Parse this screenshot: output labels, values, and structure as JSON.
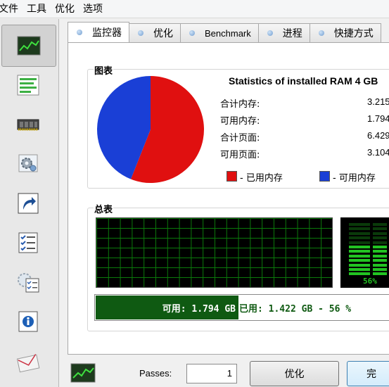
{
  "menu": [
    "文件",
    "工具",
    "优化",
    "选项"
  ],
  "sidebar": {
    "items": [
      {
        "icon": "monitor-chart-icon",
        "active": true
      },
      {
        "icon": "list-bars-icon"
      },
      {
        "icon": "ram-chip-icon"
      },
      {
        "icon": "gear-settings-icon"
      },
      {
        "icon": "shortcut-arrow-icon"
      },
      {
        "icon": "checklist-icon"
      },
      {
        "icon": "settings-checklist-icon"
      },
      {
        "icon": "info-icon"
      },
      {
        "icon": "mail-icon"
      }
    ]
  },
  "tabs": [
    {
      "label": "监控器",
      "active": true
    },
    {
      "label": "优化"
    },
    {
      "label": "Benchmark"
    },
    {
      "label": "进程"
    },
    {
      "label": "快捷方式"
    }
  ],
  "chart_group": {
    "title": "图表",
    "stats_title": "Statistics of installed RAM 4 GB",
    "rows": [
      {
        "label": "合计内存:",
        "value": "3.215"
      },
      {
        "label": "可用内存:",
        "value": "1.794"
      },
      {
        "label": "合计页面:",
        "value": "6.429"
      },
      {
        "label": "可用页面:",
        "value": "3.104"
      }
    ],
    "legend": [
      {
        "label": "- 已用内存",
        "color": "#e01010"
      },
      {
        "label": "- 可用内存",
        "color": "#1a3fd6"
      }
    ]
  },
  "chart_data": {
    "type": "pie",
    "labels": [
      "已用内存",
      "可用内存"
    ],
    "values": [
      56,
      44
    ],
    "colors": [
      "#e01010",
      "#1a3fd6"
    ]
  },
  "summary_group": {
    "title": "总表",
    "meter_label": "56%",
    "free_text": "可用: 1.794 GB",
    "used_text": "已用: 1.422 GB - 56 %",
    "usage_percent": 56,
    "colors": {
      "graph_line": "#0b7a0b",
      "meter": "#22c322",
      "bar": "#0f5a12"
    }
  },
  "footer": {
    "passes_label": "Passes:",
    "passes_value": "1",
    "optimize_button": "优化",
    "done_button": "完"
  }
}
